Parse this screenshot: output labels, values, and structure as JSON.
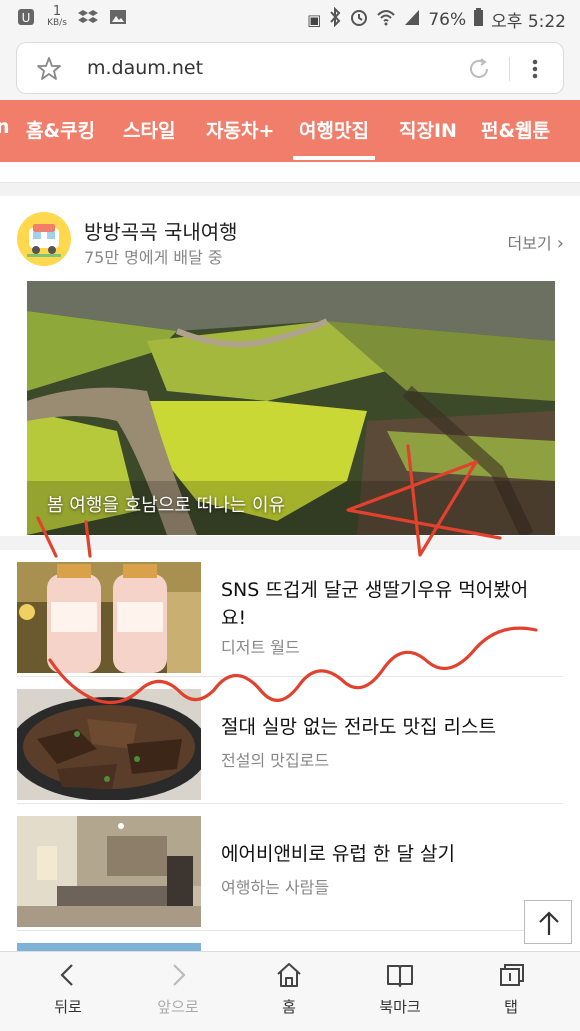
{
  "status_bar": {
    "net_speed_value": "1",
    "net_speed_unit": "KB/s",
    "battery": "76%",
    "time": "오후 5:22"
  },
  "browser": {
    "url": "m.daum.net"
  },
  "category_nav": {
    "items": [
      "n",
      "홈&쿠킹",
      "스타일",
      "자동차+",
      "여행맛집",
      "직장IN",
      "펀&웹툰"
    ],
    "active": "여행맛집"
  },
  "channel": {
    "title": "방방곡곡 국내여행",
    "subtitle": "75만 명에게 배달 중",
    "more_label": "더보기",
    "hero_caption": "봄 여행을 호남으로 떠나는 이유"
  },
  "articles": [
    {
      "title": "SNS 뜨겁게 달군 생딸기우유 먹어봤어요!",
      "source": "디저트 월드"
    },
    {
      "title": "절대 실망 없는 전라도 맛집 리스트",
      "source": "전설의 맛집로드"
    },
    {
      "title": "에어비앤비로 유럽 한 달 살기",
      "source": "여행하는 사람들"
    }
  ],
  "toolbar": {
    "back": "뒤로",
    "forward": "앞으로",
    "home": "홈",
    "bookmark": "북마크",
    "tabs": "탭"
  },
  "colors": {
    "accent": "#f07e6b",
    "scribble": "#e2412d"
  }
}
